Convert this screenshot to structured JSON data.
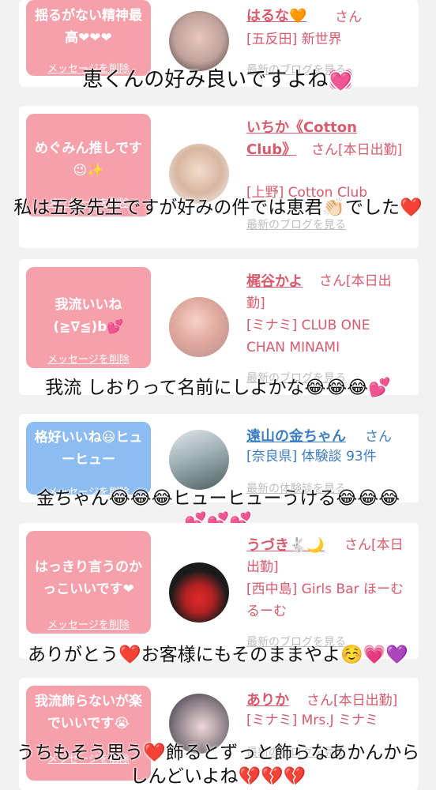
{
  "entries": [
    {
      "bubble": "揺るがない精神最高❤❤❤",
      "delete": "メッセージを削除",
      "name": "はるな",
      "name_emoji": "🧡",
      "suffix": "さん",
      "info": "[五反田] 新世界",
      "blog": "最新のブログを見る",
      "caption": "恵くんの好み良いですよね💓"
    },
    {
      "bubble": "めぐみん推しです😉✨",
      "delete": "メッセージを削除",
      "name": "いちか《Cotton Club》",
      "suffix": "さん[本日出勤]",
      "info": "[上野] Cotton Club",
      "blog": "最新のブログを見る",
      "caption": "私は五条先生ですが好みの件では恵君👏🏻でした❤️"
    },
    {
      "bubble": "我流いいね(≧∇≦)b💕",
      "delete": "メッセージを削除",
      "name": "梶谷かよ",
      "suffix": "さん[本日出勤]",
      "info": "[ミナミ] CLUB ONE CHAN MINAMI",
      "blog": "最新のブログを見る",
      "caption": "我流 しおりって名前にしよかな😂😂😂💕"
    },
    {
      "bubble": "格好いいね😃ヒューヒュー",
      "delete": "メッセージを削除",
      "name": "遠山の金ちゃん",
      "suffix": "さん",
      "info": "[奈良県] 体験談 93件",
      "blog": "最新の体験談を見る",
      "caption": "金ちゃん😂😂😂ヒューヒューうける😂😂😂💕💕💕"
    },
    {
      "bubble": "はっきり言うのかっこいいです❤",
      "delete": "メッセージを削除",
      "name": "うづき🐇🌙",
      "suffix": "さん[本日出勤]",
      "info": "[西中島] Girls Bar ほーむるーむ",
      "blog": "最新のブログを見る",
      "caption": "ありがとう❤️お客様にもそのままやよ☺️💗💜"
    },
    {
      "bubble": "我流飾らないが楽でいいです😭",
      "delete": "メッセージを削除",
      "name": "ありか",
      "suffix": "さん[本日出勤]",
      "info": "[ミナミ] Mrs.J ミナミ",
      "blog": "最新のブログを見る",
      "caption": "うちもそう思う❤️飾るとずっと飾らなあかんからしんどいよね💔💔💔"
    }
  ],
  "colors": {
    "bubble_pink": "#f6a0ab",
    "bubble_blue": "#8dbcf3",
    "name_pink": "#d65b6c",
    "name_blue": "#3d7ec2"
  }
}
